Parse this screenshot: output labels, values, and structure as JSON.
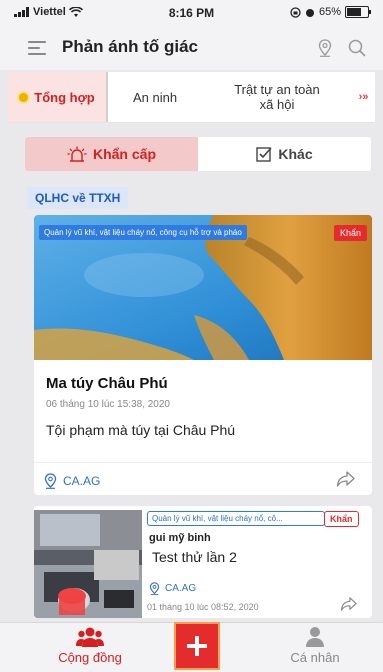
{
  "status_bar": {
    "carrier": "Viettel",
    "time": "8:16 PM",
    "battery": "65%",
    "battery_level": 0.65
  },
  "header": {
    "title": "Phản ánh tố giác",
    "menu_icon": "hamburger-menu-icon",
    "location_icon": "location-pin-icon",
    "search_icon": "search-icon"
  },
  "tabs": [
    {
      "label": "Tổng hợp",
      "active": true
    },
    {
      "label": "An ninh",
      "active": false
    },
    {
      "label": "Trật tự an toàn xã hội",
      "active": false
    },
    {
      "label": "›»",
      "active": false
    }
  ],
  "segments": {
    "urgent": "Khẩn cấp",
    "other": "Khác"
  },
  "section": {
    "label": "QLHC về TTXH"
  },
  "posts": [
    {
      "category": "Quản lý vũ khí, vật liệu cháy nổ, công cụ hỗ trợ và pháo",
      "badge": "Khẩn",
      "title": "Ma túy Châu Phú",
      "date": "06 tháng 10 lúc 15:38, 2020",
      "body": "Tội phạm mà túy tại Châu Phú",
      "location": "CA.AG"
    },
    {
      "category": "Quản lý vũ khí, vật liệu cháy nổ, cô...",
      "badge": "Khẩn",
      "user": "gui mỹ binh",
      "body": "Test thử lần 2",
      "location": "CA.AG",
      "date": "01 tháng 10 lúc 08:52, 2020"
    }
  ],
  "bottom_nav": {
    "community": "Cộng đồng",
    "add": "+",
    "profile": "Cá nhân"
  },
  "colors": {
    "accent_red": "#d81f1f",
    "link_blue": "#2f6fd1",
    "tag_blue": "#2f7be0"
  }
}
